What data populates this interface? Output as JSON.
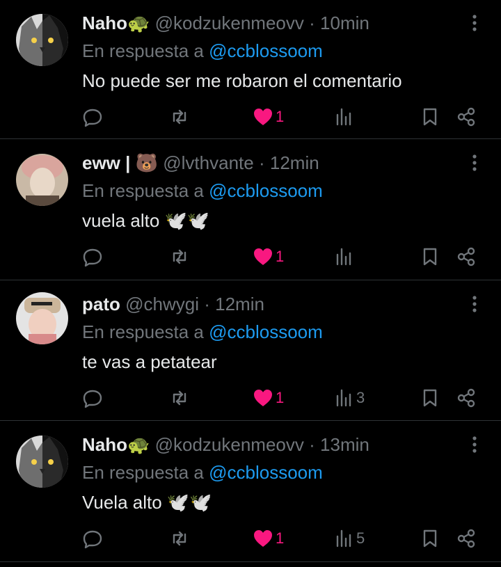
{
  "reply_prefix": "En respuesta a",
  "colors": {
    "background": "#000000",
    "text": "#e7e9ea",
    "muted": "#71767b",
    "mention": "#1d9bf0",
    "like": "#f91880"
  },
  "tweets": [
    {
      "name": "Naho🐢",
      "handle": "@kodzukenmeovv",
      "dot": "·",
      "time": "10min",
      "reply_to": "@ccblossoom",
      "text": "No puede ser me robaron el comentario",
      "likes": "1",
      "views": "",
      "avatar_icon": "wolf-avatar"
    },
    {
      "name": "eww | 🐻",
      "handle": "@lvthvante",
      "dot": "·",
      "time": "12min",
      "reply_to": "@ccblossoom",
      "text": "vuela alto 🕊️🕊️",
      "likes": "1",
      "views": "",
      "avatar_icon": "person-avatar"
    },
    {
      "name": "pato",
      "handle": "@chwygi",
      "dot": "·",
      "time": "12min",
      "reply_to": "@ccblossoom",
      "text": "te vas a petatear",
      "likes": "1",
      "views": "3",
      "avatar_icon": "person-avatar"
    },
    {
      "name": "Naho🐢",
      "handle": "@kodzukenmeovv",
      "dot": "·",
      "time": "13min",
      "reply_to": "@ccblossoom",
      "text": "Vuela alto 🕊️🕊️",
      "likes": "1",
      "views": "5",
      "avatar_icon": "wolf-avatar"
    }
  ]
}
